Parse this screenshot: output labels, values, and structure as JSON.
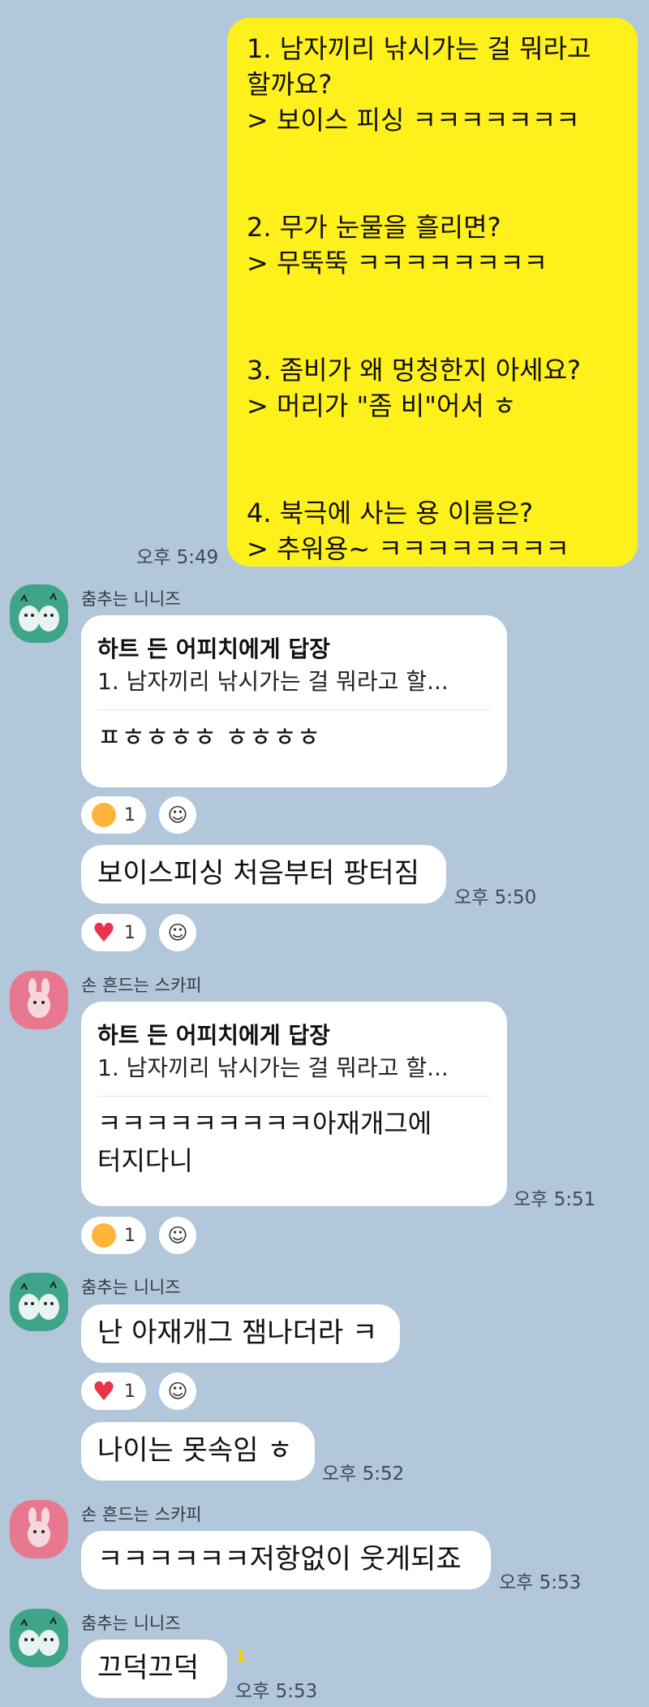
{
  "my_message": {
    "lines": [
      "1. 남자끼리 낚시가는 걸 뭐라고",
      "할까요?",
      "> 보이스 피싱 ㅋㅋㅋㅋㅋㅋㅋ",
      "2. 무가 눈물을 흘리면?",
      "> 무뚝뚝 ㅋㅋㅋㅋㅋㅋㅋㅋ",
      "3. 좀비가 왜 멍청한지 아세요?",
      "> 머리가 \"좀 비\"어서 ㅎ",
      "4. 북극에 사는 용 이름은?",
      "> 추워용~ ㅋㅋㅋㅋㅋㅋㅋㅋ"
    ],
    "time": "오후 5:49"
  },
  "msg1": {
    "sender": "춤추는 니니즈",
    "reply_title": "하트 든 어피치에게 답장",
    "reply_quote": "1. 남자끼리 낚시가는 걸 뭐라고 할...",
    "text": "ㅍㅎㅎㅎㅎ ㅎㅎㅎㅎ",
    "reaction": {
      "emoji": "laugh-emoji",
      "count": "1"
    }
  },
  "msg2": {
    "text": "보이스피싱 처음부터 팡터짐",
    "time": "오후 5:50",
    "reaction": {
      "emoji": "heart-emoji",
      "count": "1"
    }
  },
  "msg3": {
    "sender": "손 흔드는 스카피",
    "reply_title": "하트 든 어피치에게 답장",
    "reply_quote": "1. 남자끼리 낚시가는 걸 뭐라고 할...",
    "text_line1": "ㅋㅋㅋㅋㅋㅋㅋㅋㅋ아재개그에",
    "text_line2": "터지다니",
    "time": "오후 5:51",
    "reaction": {
      "emoji": "laugh-emoji",
      "count": "1"
    }
  },
  "msg4": {
    "sender": "춤추는 니니즈",
    "text": "난 아재개그 잼나더라 ㅋ",
    "reaction": {
      "emoji": "heart-emoji",
      "count": "1"
    }
  },
  "msg5": {
    "text": "나이는 못속임 ㅎ",
    "time": "오후 5:52"
  },
  "msg6": {
    "sender": "손 흔드는 스카피",
    "text": "ㅋㅋㅋㅋㅋㅋ저항없이 웃게되죠",
    "time": "오후 5:53"
  },
  "msg7": {
    "sender": "춤추는 니니즈",
    "text": "끄덕끄덕",
    "unread": "1",
    "time": "오후 5:53"
  },
  "icons": {
    "add_reaction": "add-reaction-icon"
  },
  "colors": {
    "background": "#b2c7d9",
    "my_bubble": "#fef01b",
    "other_bubble": "#ffffff",
    "unread": "#f5d000"
  }
}
